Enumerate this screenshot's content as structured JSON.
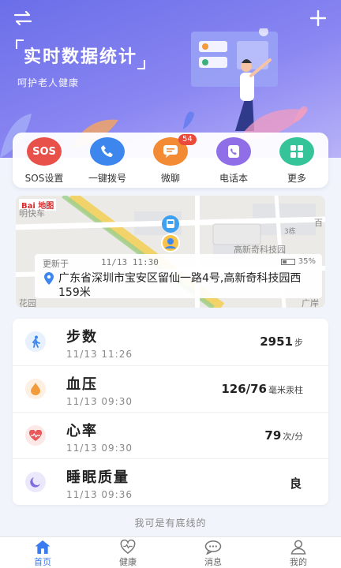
{
  "header": {
    "slogan_title": "实时数据统计",
    "slogan_sub": "呵护老人健康"
  },
  "actions": [
    {
      "label": "SOS设置",
      "icon": "sos-icon",
      "text": "SOS",
      "color": "#e8504a"
    },
    {
      "label": "一键拨号",
      "icon": "phone-icon",
      "color": "#3c86ee"
    },
    {
      "label": "微聊",
      "icon": "chat-icon",
      "color": "#f28b33",
      "badge": "54"
    },
    {
      "label": "电话本",
      "icon": "phonebook-icon",
      "color": "#8f6ee8"
    },
    {
      "label": "更多",
      "icon": "grid-icon",
      "color": "#35c39a"
    }
  ],
  "map": {
    "provider": "Bai 地图",
    "labels": [
      "明快车",
      "高新奇科技园",
      "3栋",
      "百",
      "花园",
      "广岸"
    ],
    "location": {
      "updated_label": "更新于",
      "updated_time": "11/13 11:30",
      "battery": "35%",
      "battery_level": 0.35,
      "address": "广东省深圳市宝安区留仙一路4号,高新奇科技园西159米"
    }
  },
  "health": [
    {
      "name": "步数",
      "time": "11/13 11:26",
      "value": "2951",
      "unit": "步",
      "icon": "walk-icon",
      "color": "#3c86ee",
      "bg": "#e7f0fd"
    },
    {
      "name": "血压",
      "time": "11/13 09:30",
      "value": "126/76",
      "unit": "毫米汞柱",
      "icon": "drop-icon",
      "color": "#f29b3a",
      "bg": "#fdf0e2"
    },
    {
      "name": "心率",
      "time": "11/13 09:30",
      "value": "79",
      "unit": "次/分",
      "icon": "heart-icon",
      "color": "#e85a5a",
      "bg": "#fde8e8"
    },
    {
      "name": "睡眠质量",
      "time": "11/13 09:36",
      "value": "良",
      "unit": "",
      "icon": "moon-icon",
      "color": "#7f6ee0",
      "bg": "#ece8fb"
    }
  ],
  "footer_note": "我可是有底线的",
  "tabs": [
    {
      "label": "首页",
      "icon": "home-icon",
      "active": true
    },
    {
      "label": "健康",
      "icon": "health-icon",
      "active": false
    },
    {
      "label": "消息",
      "icon": "message-icon",
      "active": false
    },
    {
      "label": "我的",
      "icon": "profile-icon",
      "active": false
    }
  ]
}
